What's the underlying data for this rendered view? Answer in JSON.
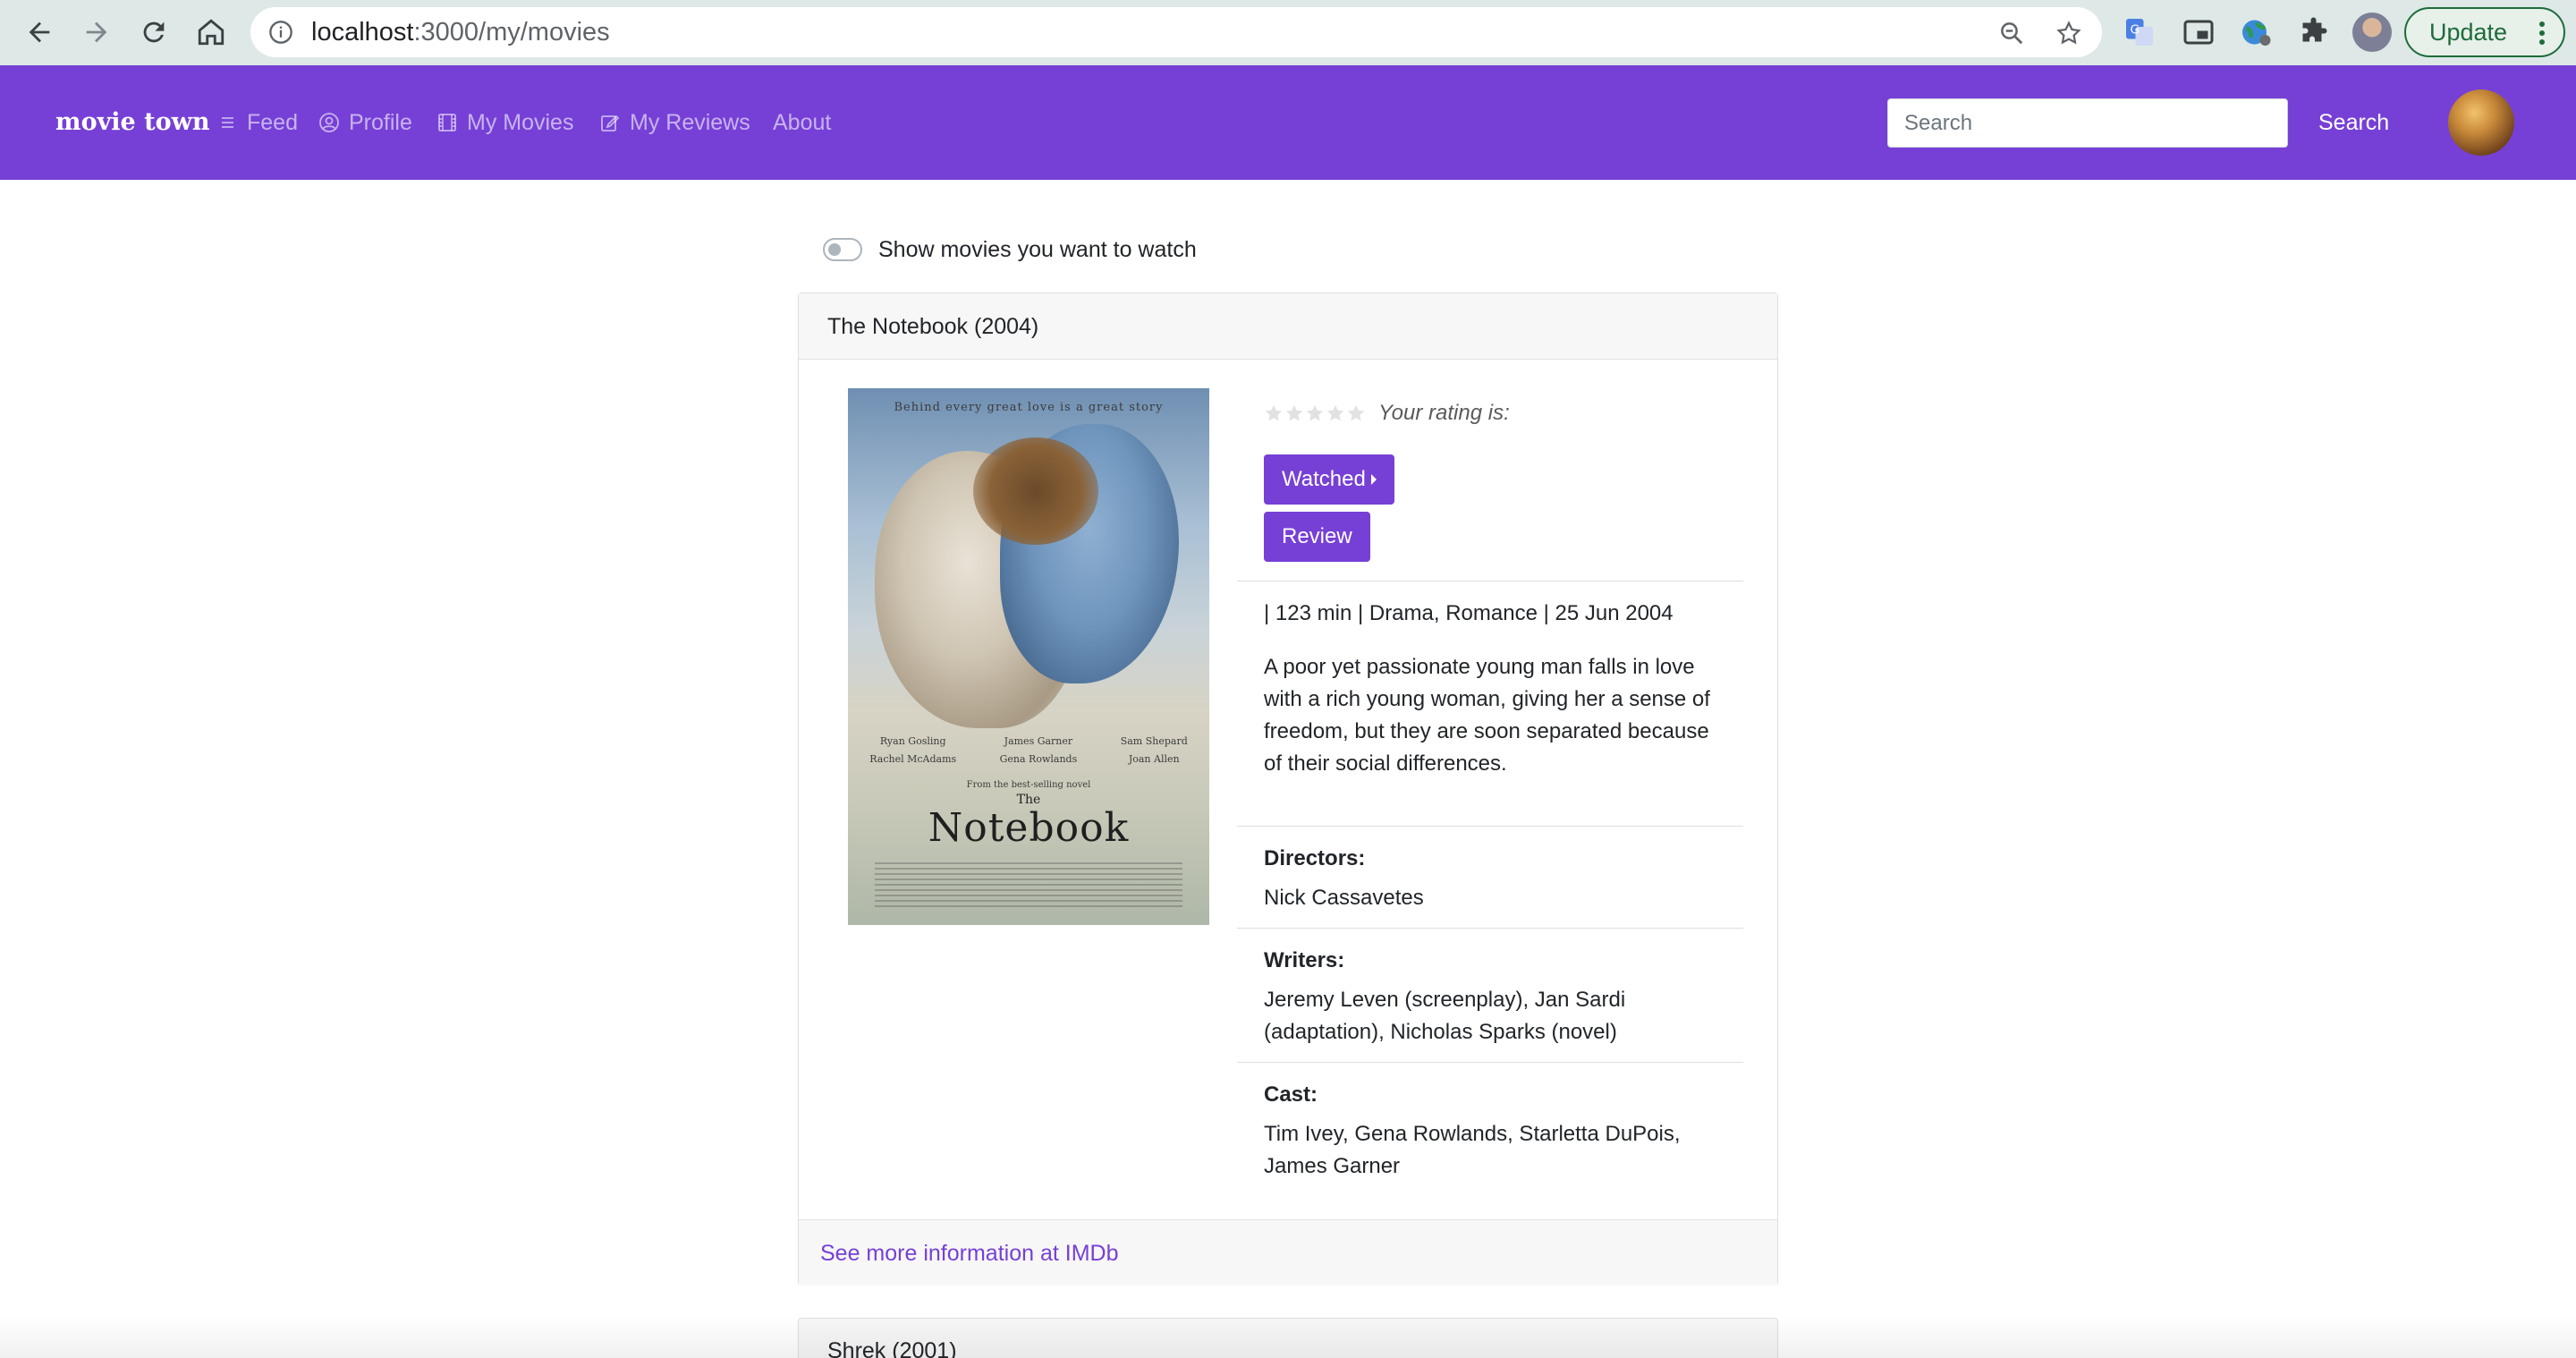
{
  "browser": {
    "url_host": "localhost",
    "url_path": ":3000/my/movies",
    "update_label": "Update"
  },
  "navbar": {
    "brand": "movie town",
    "items": [
      {
        "label": "Feed",
        "icon": "menu-icon"
      },
      {
        "label": "Profile",
        "icon": "user-circle-icon"
      },
      {
        "label": "My Movies",
        "icon": "film-icon"
      },
      {
        "label": "My Reviews",
        "icon": "edit-icon"
      },
      {
        "label": "About",
        "icon": ""
      }
    ],
    "search_placeholder": "Search",
    "search_button": "Search"
  },
  "filter": {
    "toggle_label": "Show movies you want to watch",
    "toggle_on": false
  },
  "movie": {
    "header": "The Notebook (2004)",
    "rating_label": "Your rating is:",
    "rating_value": 0,
    "rating_max": 5,
    "watched_button": "Watched",
    "review_button": "Review",
    "meta": "| 123 min | Drama, Romance | 25 Jun 2004",
    "plot": "A poor yet passionate young man falls in love with a rich young woman, giving her a sense of freedom, but they are soon separated because of their social differences.",
    "directors_label": "Directors:",
    "directors": "Nick Cassavetes",
    "writers_label": "Writers:",
    "writers": "Jeremy Leven (screenplay), Jan Sardi (adaptation), Nicholas Sparks (novel)",
    "cast_label": "Cast:",
    "cast": "Tim Ivey, Gena Rowlands, Starletta DuPois, James Garner",
    "imdb_link": "See more information at IMDb",
    "poster": {
      "tagline": "Behind every great love is a great story",
      "credit_1": "Ryan Gosling",
      "credit_2": "Rachel McAdams",
      "credit_3": "James Garner",
      "credit_4": "Gena Rowlands",
      "credit_5": "Sam Shepard",
      "credit_6": "Joan Allen",
      "from": "From the best-selling novel",
      "the": "The",
      "title": "Notebook"
    }
  },
  "next_movie": {
    "header": "Shrek (2001)"
  },
  "colors": {
    "accent": "#7640d6",
    "browser_bar": "#dde8e7"
  }
}
